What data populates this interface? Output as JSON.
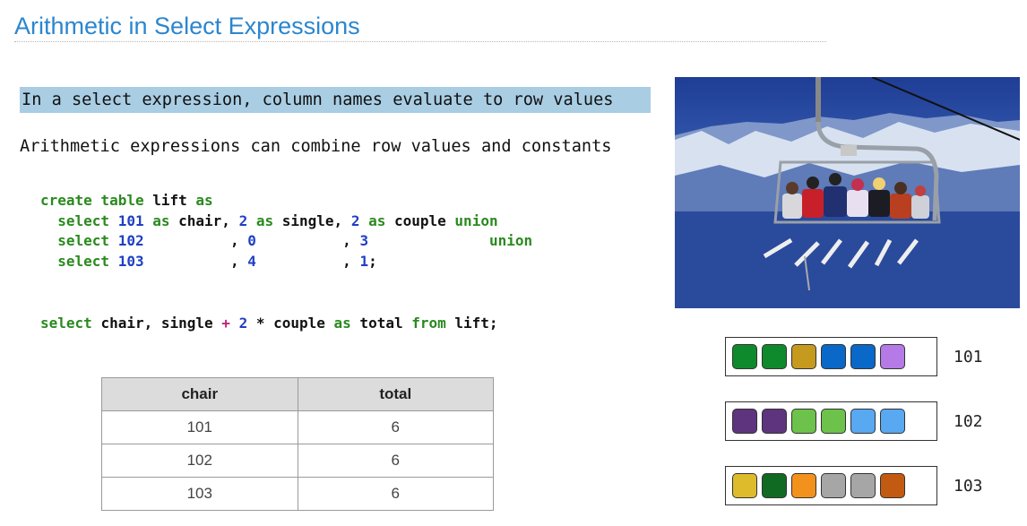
{
  "title": "Arithmetic in Select Expressions",
  "line1": "In a select expression, column names evaluate to row values",
  "line2": "Arithmetic expressions can combine row values and constants",
  "code": {
    "l1": [
      {
        "c": "kw",
        "t": "create table "
      },
      {
        "c": "",
        "t": "lift "
      },
      {
        "c": "kw",
        "t": "as"
      }
    ],
    "l2": [
      {
        "c": "kw",
        "t": "  select "
      },
      {
        "c": "num",
        "t": "101"
      },
      {
        "c": "kw",
        "t": " as "
      },
      {
        "c": "",
        "t": "chair, "
      },
      {
        "c": "num",
        "t": "2"
      },
      {
        "c": "kw",
        "t": " as "
      },
      {
        "c": "",
        "t": "single, "
      },
      {
        "c": "num",
        "t": "2"
      },
      {
        "c": "kw",
        "t": " as "
      },
      {
        "c": "",
        "t": "couple "
      },
      {
        "c": "kw",
        "t": "union"
      }
    ],
    "l3": [
      {
        "c": "kw",
        "t": "  select "
      },
      {
        "c": "num",
        "t": "102"
      },
      {
        "c": "",
        "t": "          , "
      },
      {
        "c": "num",
        "t": "0"
      },
      {
        "c": "",
        "t": "          , "
      },
      {
        "c": "num",
        "t": "3"
      },
      {
        "c": "kw",
        "t": "              union"
      }
    ],
    "l4": [
      {
        "c": "kw",
        "t": "  select "
      },
      {
        "c": "num",
        "t": "103"
      },
      {
        "c": "",
        "t": "          , "
      },
      {
        "c": "num",
        "t": "4"
      },
      {
        "c": "",
        "t": "          , "
      },
      {
        "c": "num",
        "t": "1"
      },
      {
        "c": "",
        "t": ";"
      }
    ],
    "l5": [
      {
        "c": "kw",
        "t": "select "
      },
      {
        "c": "",
        "t": "chair, single "
      },
      {
        "c": "op",
        "t": "+"
      },
      {
        "c": "num",
        "t": " 2"
      },
      {
        "c": "",
        "t": " * couple "
      },
      {
        "c": "kw",
        "t": "as"
      },
      {
        "c": "",
        "t": " total "
      },
      {
        "c": "kw",
        "t": "from"
      },
      {
        "c": "",
        "t": " lift;"
      }
    ]
  },
  "table": {
    "headers": [
      "chair",
      "total"
    ],
    "rows": [
      [
        "101",
        "6"
      ],
      [
        "102",
        "6"
      ],
      [
        "103",
        "6"
      ]
    ]
  },
  "seats": [
    {
      "label": "101",
      "colors": [
        "#0e8a2c",
        "#0e8a2c",
        "#c59a1f",
        "#0a68c8",
        "#0a68c8",
        "#b57ae6"
      ]
    },
    {
      "label": "102",
      "colors": [
        "#5e347e",
        "#5e347e",
        "#6cc24a",
        "#6cc24a",
        "#58a8f2",
        "#58a8f2"
      ]
    },
    {
      "label": "103",
      "colors": [
        "#ddbb2b",
        "#106a22",
        "#f2921c",
        "#a6a6a6",
        "#a6a6a6",
        "#c35a12"
      ]
    }
  ],
  "colors": {
    "title": "#2b86cf",
    "highlight": "#a9cde3",
    "keyword": "#2a8a1e",
    "number": "#1f3fc4"
  }
}
